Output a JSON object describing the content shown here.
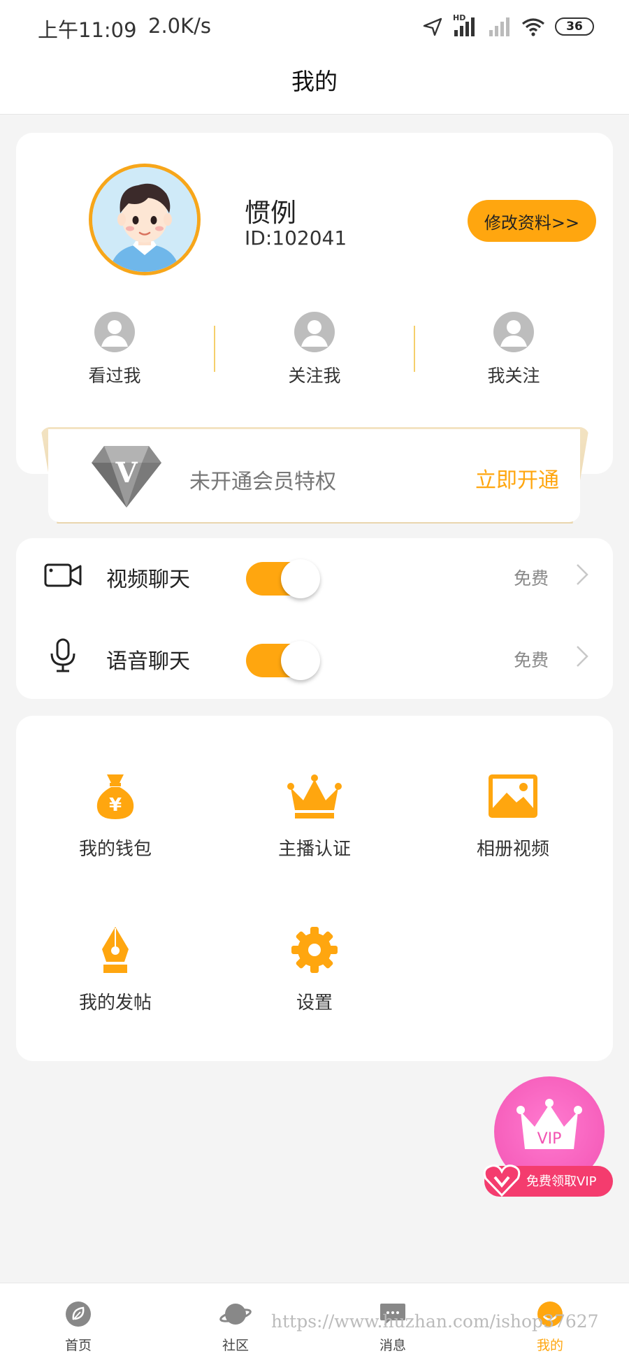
{
  "status_bar": {
    "time": "上午11:09",
    "speed": "2.0K/s",
    "hd_label": "HD",
    "battery": "36",
    "icons": [
      "location-arrow-icon",
      "signal-icon",
      "signal-weak-icon",
      "wifi-icon",
      "battery-icon"
    ]
  },
  "header": {
    "title": "我的"
  },
  "profile": {
    "name": "惯例",
    "id": "ID:102041",
    "edit_button": "修改资料>>",
    "avatar_icon": "boy-avatar"
  },
  "stats": [
    {
      "label": "看过我",
      "icon": "user-icon"
    },
    {
      "label": "关注我",
      "icon": "user-icon"
    },
    {
      "label": "我关注",
      "icon": "user-icon"
    }
  ],
  "vip_banner": {
    "gem_letter": "V",
    "text": "未开通会员特权",
    "action": "立即开通"
  },
  "chat": [
    {
      "label": "视频聊天",
      "price": "免费",
      "enabled": true,
      "icon": "video-camera-icon"
    },
    {
      "label": "语音聊天",
      "price": "免费",
      "enabled": true,
      "icon": "microphone-icon"
    }
  ],
  "menu": [
    {
      "label": "我的钱包",
      "icon": "money-bag-icon"
    },
    {
      "label": "主播认证",
      "icon": "crown-icon"
    },
    {
      "label": "相册视频",
      "icon": "photo-icon"
    },
    {
      "label": "我的发帖",
      "icon": "pen-nib-icon"
    },
    {
      "label": "设置",
      "icon": "gear-icon"
    }
  ],
  "floating_vip": {
    "badge": "VIP",
    "label": "免费领取VIP"
  },
  "bottom_nav": [
    {
      "label": "首页",
      "icon": "leaf-icon",
      "active": false
    },
    {
      "label": "社区",
      "icon": "planet-icon",
      "active": false
    },
    {
      "label": "消息",
      "icon": "chat-bubble-icon",
      "active": false
    },
    {
      "label": "我的",
      "icon": "profile-icon",
      "active": true
    }
  ],
  "watermark": "https://www.huzhan.com/ishop37627",
  "colors": {
    "accent": "#ffa60f",
    "vip_pink": "#f253b2",
    "vip_red": "#f43c6e",
    "avatar_ring": "#f7a61a"
  }
}
